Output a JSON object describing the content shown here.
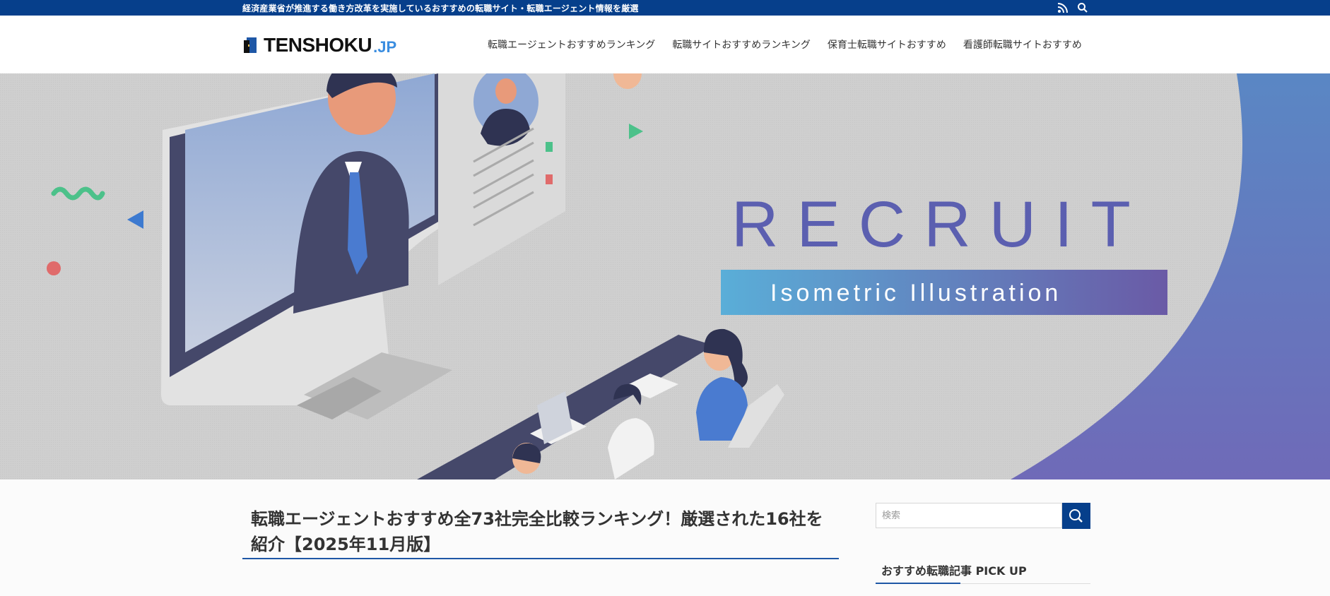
{
  "topbar": {
    "tagline": "経済産業省が推進する働き方改革を実施しているおすすめの転職サイト・転職エージェント情報を厳選",
    "icons": [
      "rss-icon",
      "search-icon"
    ]
  },
  "header": {
    "logo_main": "TENSHOKU",
    "logo_sub": ".JP",
    "nav": [
      {
        "label": "転職エージェントおすすめランキング"
      },
      {
        "label": "転職サイトおすすめランキング"
      },
      {
        "label": "保育士転職サイトおすすめ"
      },
      {
        "label": "看護師転職サイトおすすめ"
      }
    ]
  },
  "hero": {
    "headline": "RECRUIT",
    "subline": "Isometric Illustration",
    "colors": {
      "accent": "#5b5fb0",
      "band_start": "#5aaed8",
      "band_end": "#6a5aa6",
      "panel": "#4f6fb8"
    }
  },
  "article": {
    "title_line1": "転職エージェントおすすめ全73社完全比較ランキング！厳選された16社を",
    "title_line2": "紹介【2025年11月版】"
  },
  "sidebar": {
    "search_placeholder": "検索",
    "widget_title": "おすすめ転職記事 PICK UP"
  },
  "colors": {
    "brand": "#063f8b",
    "accent_blue": "#1e57a6",
    "logo_blue": "#3a8de0"
  }
}
